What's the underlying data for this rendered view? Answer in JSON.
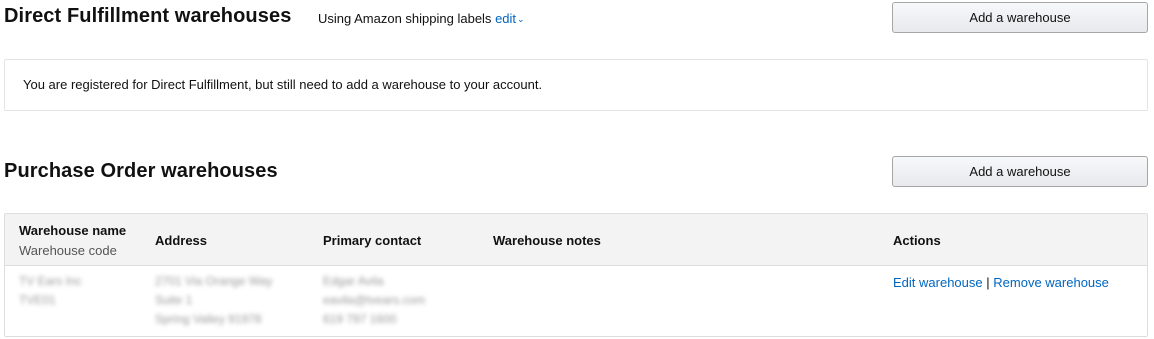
{
  "direct_fulfillment": {
    "title": "Direct Fulfillment warehouses",
    "labels_text": "Using Amazon shipping labels",
    "edit_label": "edit",
    "add_button": "Add a warehouse",
    "notice": "You are registered for Direct Fulfillment, but still need to add a warehouse to your account."
  },
  "purchase_order": {
    "title": "Purchase Order warehouses",
    "add_button": "Add a warehouse",
    "table": {
      "headers": {
        "name": "Warehouse name",
        "code": "Warehouse code",
        "address": "Address",
        "contact": "Primary contact",
        "notes": "Warehouse notes",
        "actions": "Actions"
      },
      "rows": [
        {
          "name": "TV Ears Inc",
          "code": "TVE01",
          "address": [
            "2701 Via Orange Way",
            "Suite 1",
            "Spring Valley 91978"
          ],
          "contact": [
            "Edgar Avila",
            "eavila@tvears.com",
            "619 797 1600"
          ],
          "notes": "",
          "edit_label": "Edit warehouse",
          "separator": "|",
          "remove_label": "Remove warehouse"
        }
      ]
    }
  },
  "colors": {
    "link": "#0066c0",
    "header_bg": "#f3f3f3",
    "border": "#dddddd"
  },
  "icons": {
    "edit_dropdown": "chevron-down-icon"
  }
}
